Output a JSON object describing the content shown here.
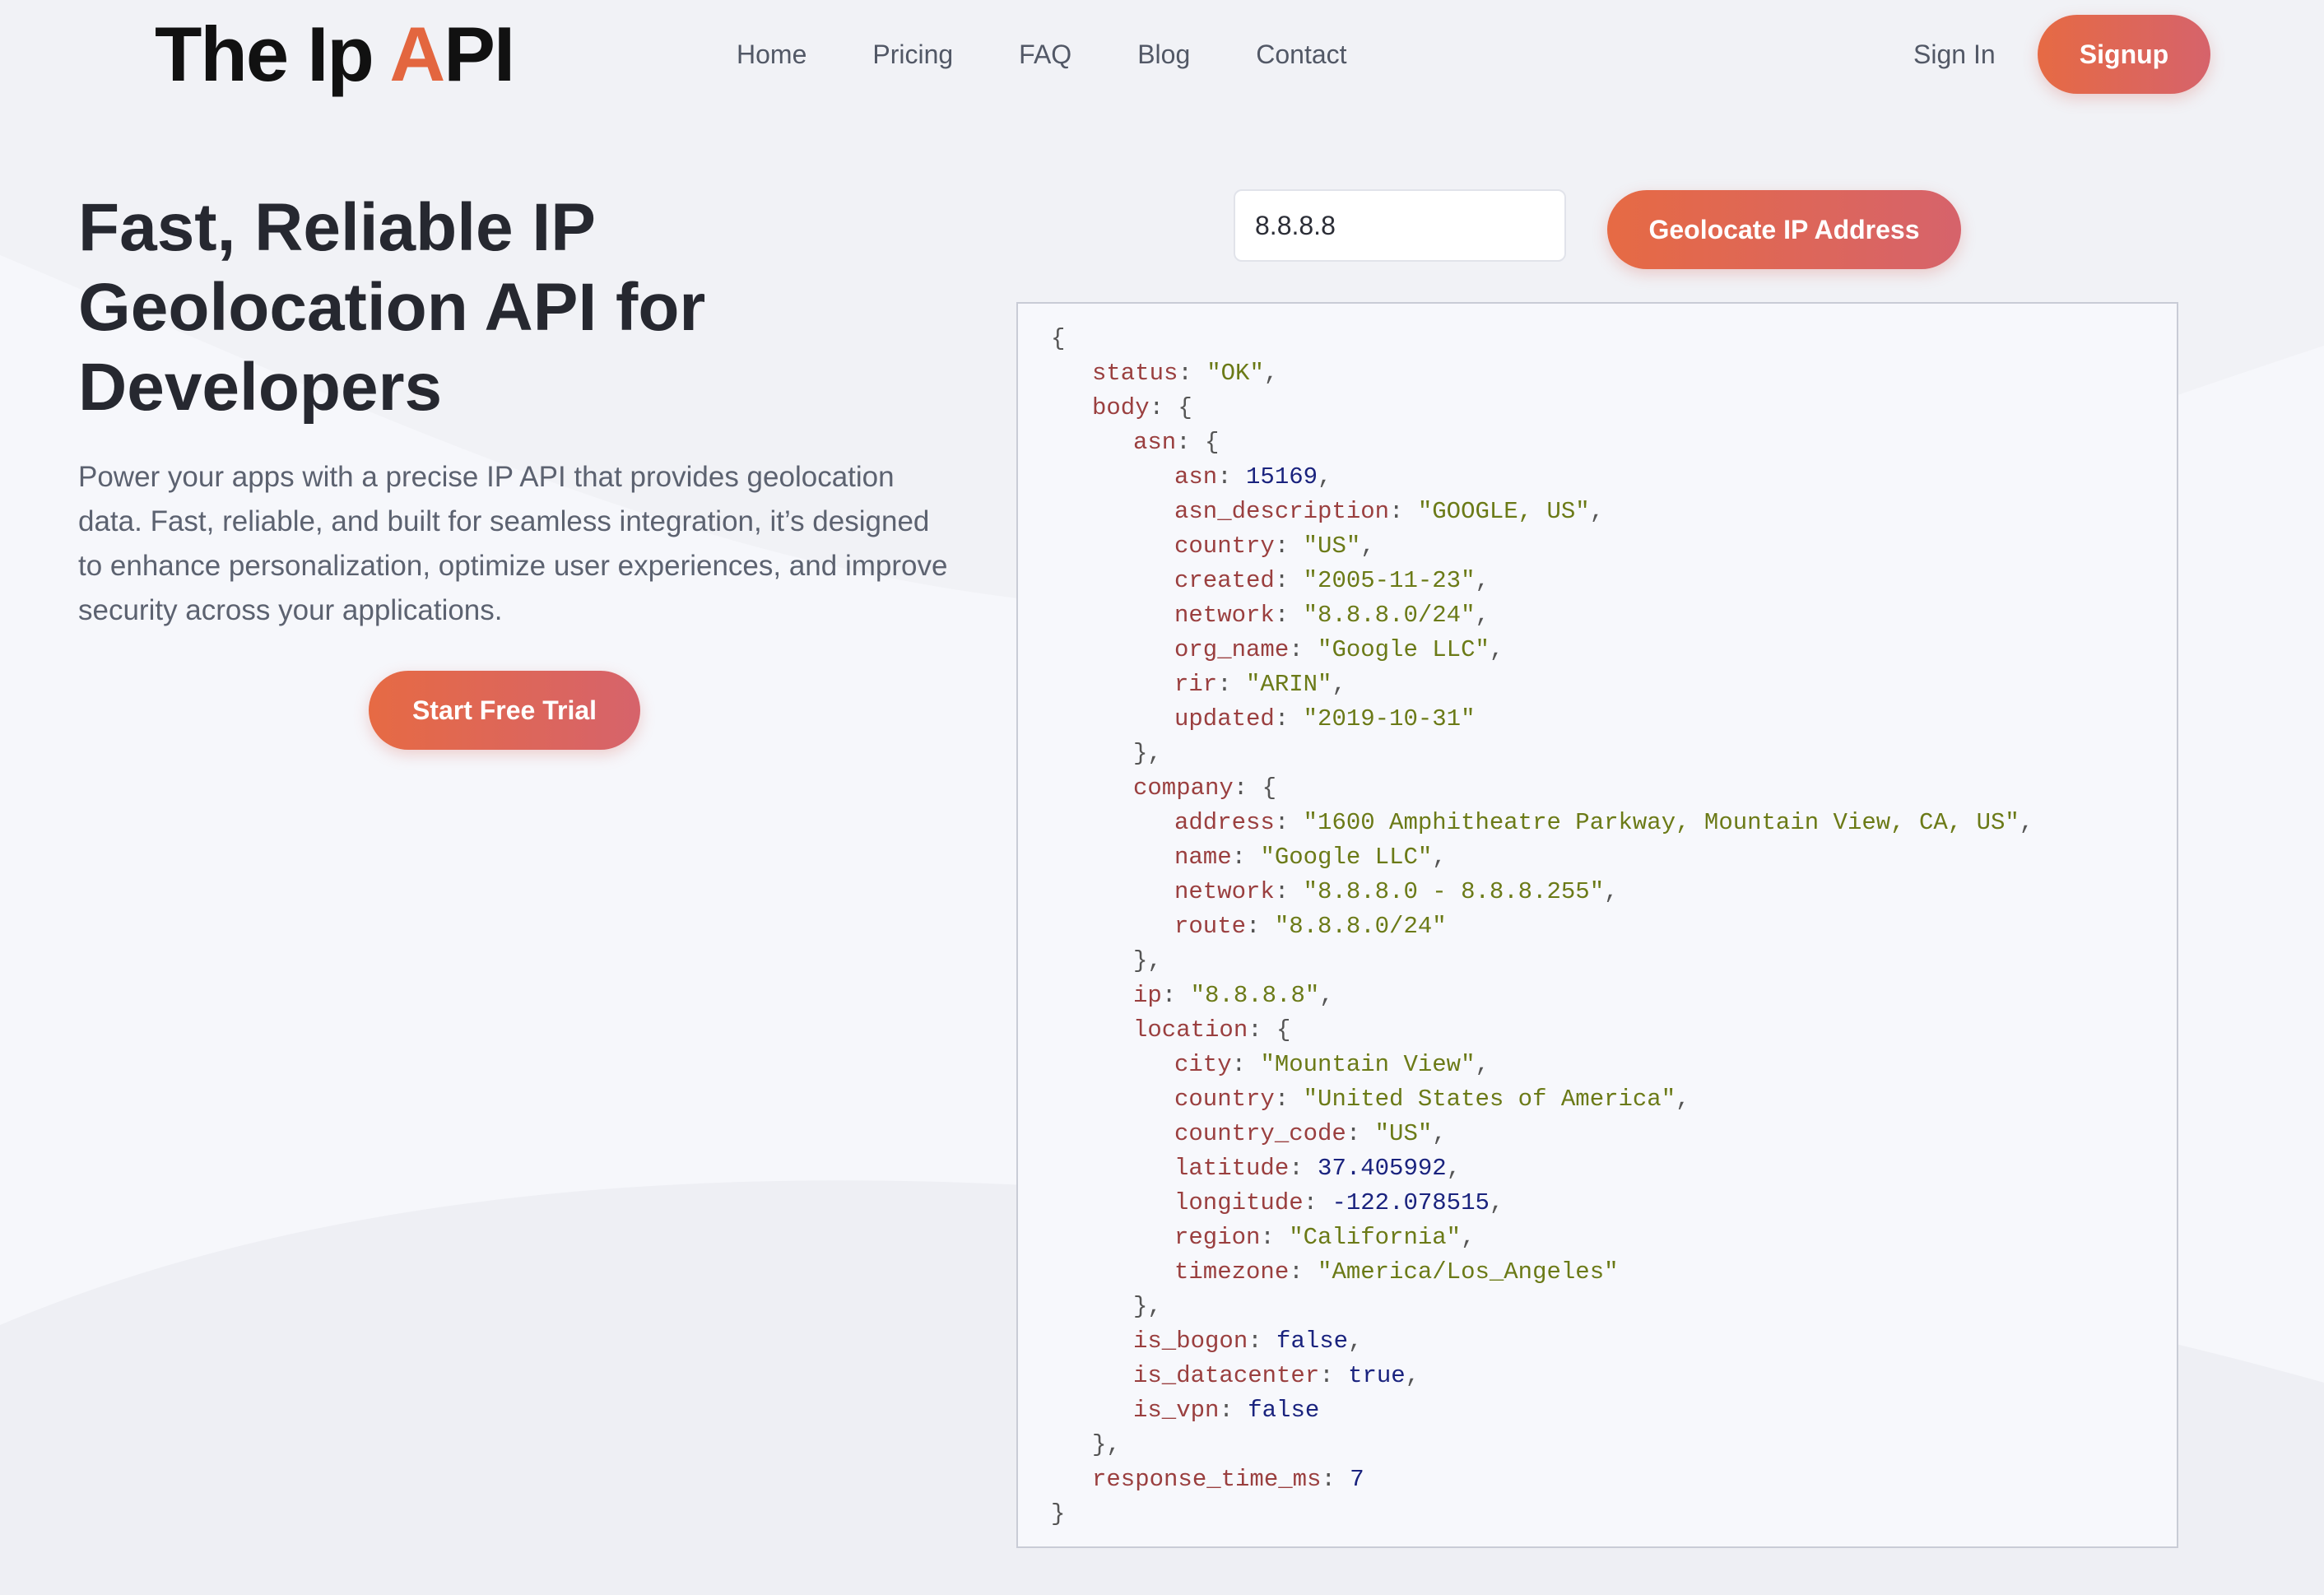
{
  "header": {
    "logo_prefix": "The Ip ",
    "logo_accent": "A",
    "logo_suffix": "PI",
    "nav": [
      "Home",
      "Pricing",
      "FAQ",
      "Blog",
      "Contact"
    ],
    "signin_label": "Sign In",
    "signup_label": "Signup"
  },
  "hero": {
    "title": "Fast, Reliable IP Geolocation API for Developers",
    "description": "Power your apps with a precise IP API that provides geolocation data. Fast, reliable, and built for seamless integration, it’s designed to enhance personalization, optimize user experiences, and improve security across your applications.",
    "cta_label": "Start Free Trial"
  },
  "lookup": {
    "ip_value": "8.8.8.8",
    "button_label": "Geolocate IP Address"
  },
  "colors": {
    "accent": "#e3663f",
    "button_gradient_start": "#e66a44",
    "button_gradient_end": "#d6636b"
  },
  "response_lines": [
    {
      "indent": 0,
      "parts": [
        [
          "p",
          "{"
        ]
      ]
    },
    {
      "indent": 1,
      "parts": [
        [
          "k",
          "status"
        ],
        [
          "p",
          ": "
        ],
        [
          "s",
          "\"OK\""
        ],
        [
          "p",
          ","
        ]
      ]
    },
    {
      "indent": 1,
      "parts": [
        [
          "k",
          "body"
        ],
        [
          "p",
          ": {"
        ]
      ]
    },
    {
      "indent": 2,
      "parts": [
        [
          "k",
          "asn"
        ],
        [
          "p",
          ": {"
        ]
      ]
    },
    {
      "indent": 3,
      "parts": [
        [
          "k",
          "asn"
        ],
        [
          "p",
          ": "
        ],
        [
          "n",
          "15169"
        ],
        [
          "p",
          ","
        ]
      ]
    },
    {
      "indent": 3,
      "parts": [
        [
          "k",
          "asn_description"
        ],
        [
          "p",
          ": "
        ],
        [
          "s",
          "\"GOOGLE, US\""
        ],
        [
          "p",
          ","
        ]
      ]
    },
    {
      "indent": 3,
      "parts": [
        [
          "k",
          "country"
        ],
        [
          "p",
          ": "
        ],
        [
          "s",
          "\"US\""
        ],
        [
          "p",
          ","
        ]
      ]
    },
    {
      "indent": 3,
      "parts": [
        [
          "k",
          "created"
        ],
        [
          "p",
          ": "
        ],
        [
          "s",
          "\"2005-11-23\""
        ],
        [
          "p",
          ","
        ]
      ]
    },
    {
      "indent": 3,
      "parts": [
        [
          "k",
          "network"
        ],
        [
          "p",
          ": "
        ],
        [
          "s",
          "\"8.8.8.0/24\""
        ],
        [
          "p",
          ","
        ]
      ]
    },
    {
      "indent": 3,
      "parts": [
        [
          "k",
          "org_name"
        ],
        [
          "p",
          ": "
        ],
        [
          "s",
          "\"Google LLC\""
        ],
        [
          "p",
          ","
        ]
      ]
    },
    {
      "indent": 3,
      "parts": [
        [
          "k",
          "rir"
        ],
        [
          "p",
          ": "
        ],
        [
          "s",
          "\"ARIN\""
        ],
        [
          "p",
          ","
        ]
      ]
    },
    {
      "indent": 3,
      "parts": [
        [
          "k",
          "updated"
        ],
        [
          "p",
          ": "
        ],
        [
          "s",
          "\"2019-10-31\""
        ]
      ]
    },
    {
      "indent": 2,
      "parts": [
        [
          "p",
          "},"
        ]
      ]
    },
    {
      "indent": 2,
      "parts": [
        [
          "k",
          "company"
        ],
        [
          "p",
          ": {"
        ]
      ]
    },
    {
      "indent": 3,
      "parts": [
        [
          "k",
          "address"
        ],
        [
          "p",
          ": "
        ],
        [
          "s",
          "\"1600 Amphitheatre Parkway, Mountain View, CA, US\""
        ],
        [
          "p",
          ","
        ]
      ]
    },
    {
      "indent": 3,
      "parts": [
        [
          "k",
          "name"
        ],
        [
          "p",
          ": "
        ],
        [
          "s",
          "\"Google LLC\""
        ],
        [
          "p",
          ","
        ]
      ]
    },
    {
      "indent": 3,
      "parts": [
        [
          "k",
          "network"
        ],
        [
          "p",
          ": "
        ],
        [
          "s",
          "\"8.8.8.0 - 8.8.8.255\""
        ],
        [
          "p",
          ","
        ]
      ]
    },
    {
      "indent": 3,
      "parts": [
        [
          "k",
          "route"
        ],
        [
          "p",
          ": "
        ],
        [
          "s",
          "\"8.8.8.0/24\""
        ]
      ]
    },
    {
      "indent": 2,
      "parts": [
        [
          "p",
          "},"
        ]
      ]
    },
    {
      "indent": 2,
      "parts": [
        [
          "k",
          "ip"
        ],
        [
          "p",
          ": "
        ],
        [
          "s",
          "\"8.8.8.8\""
        ],
        [
          "p",
          ","
        ]
      ]
    },
    {
      "indent": 2,
      "parts": [
        [
          "k",
          "location"
        ],
        [
          "p",
          ": {"
        ]
      ]
    },
    {
      "indent": 3,
      "parts": [
        [
          "k",
          "city"
        ],
        [
          "p",
          ": "
        ],
        [
          "s",
          "\"Mountain View\""
        ],
        [
          "p",
          ","
        ]
      ]
    },
    {
      "indent": 3,
      "parts": [
        [
          "k",
          "country"
        ],
        [
          "p",
          ": "
        ],
        [
          "s",
          "\"United States of America\""
        ],
        [
          "p",
          ","
        ]
      ]
    },
    {
      "indent": 3,
      "parts": [
        [
          "k",
          "country_code"
        ],
        [
          "p",
          ": "
        ],
        [
          "s",
          "\"US\""
        ],
        [
          "p",
          ","
        ]
      ]
    },
    {
      "indent": 3,
      "parts": [
        [
          "k",
          "latitude"
        ],
        [
          "p",
          ": "
        ],
        [
          "n",
          "37.405992"
        ],
        [
          "p",
          ","
        ]
      ]
    },
    {
      "indent": 3,
      "parts": [
        [
          "k",
          "longitude"
        ],
        [
          "p",
          ": "
        ],
        [
          "n",
          "-122.078515"
        ],
        [
          "p",
          ","
        ]
      ]
    },
    {
      "indent": 3,
      "parts": [
        [
          "k",
          "region"
        ],
        [
          "p",
          ": "
        ],
        [
          "s",
          "\"California\""
        ],
        [
          "p",
          ","
        ]
      ]
    },
    {
      "indent": 3,
      "parts": [
        [
          "k",
          "timezone"
        ],
        [
          "p",
          ": "
        ],
        [
          "s",
          "\"America/Los_Angeles\""
        ]
      ]
    },
    {
      "indent": 2,
      "parts": [
        [
          "p",
          "},"
        ]
      ]
    },
    {
      "indent": 2,
      "parts": [
        [
          "k",
          "is_bogon"
        ],
        [
          "p",
          ": "
        ],
        [
          "n",
          "false"
        ],
        [
          "p",
          ","
        ]
      ]
    },
    {
      "indent": 2,
      "parts": [
        [
          "k",
          "is_datacenter"
        ],
        [
          "p",
          ": "
        ],
        [
          "n",
          "true"
        ],
        [
          "p",
          ","
        ]
      ]
    },
    {
      "indent": 2,
      "parts": [
        [
          "k",
          "is_vpn"
        ],
        [
          "p",
          ": "
        ],
        [
          "n",
          "false"
        ]
      ]
    },
    {
      "indent": 1,
      "parts": [
        [
          "p",
          "},"
        ]
      ]
    },
    {
      "indent": 1,
      "parts": [
        [
          "k",
          "response_time_ms"
        ],
        [
          "p",
          ": "
        ],
        [
          "n",
          "7"
        ]
      ]
    },
    {
      "indent": 0,
      "parts": [
        [
          "p",
          "}"
        ]
      ]
    }
  ]
}
